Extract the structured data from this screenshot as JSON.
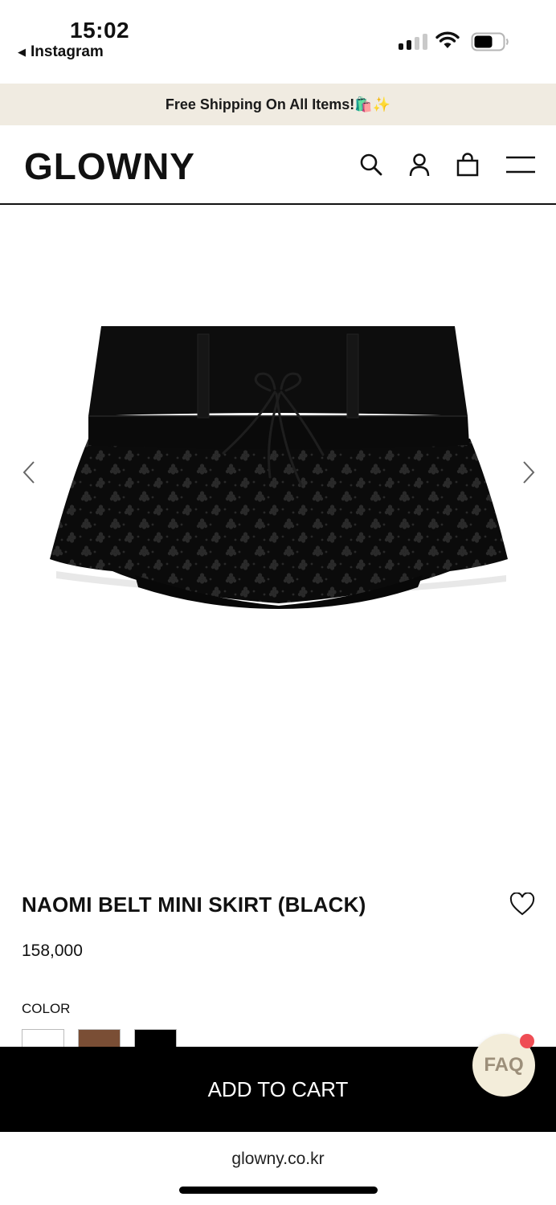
{
  "status_bar": {
    "time": "15:02",
    "back_app": "Instagram",
    "back_icon": "back-triangle-icon",
    "signal_bars": 4,
    "signal_active": 2
  },
  "announcement": {
    "text": "Free Shipping On All Items!🛍️✨"
  },
  "header": {
    "logo": "GLOWNY",
    "icons": [
      "search-icon",
      "account-icon",
      "bag-icon",
      "menu-icon"
    ]
  },
  "product": {
    "title": "NAOMI BELT MINI SKIRT (BLACK)",
    "price": "158,000",
    "color_label": "COLOR",
    "swatches": [
      {
        "name": "white",
        "color": "#ffffff"
      },
      {
        "name": "brown",
        "color": "#7a4e35"
      },
      {
        "name": "black",
        "color": "#000000"
      }
    ],
    "image_alt": "black eyelet mini skirt with belt and drawstring"
  },
  "cart": {
    "label": "ADD TO CART"
  },
  "faq": {
    "label": "FAQ",
    "notification_color": "#ef4d54"
  },
  "browser": {
    "url": "glowny.co.kr"
  },
  "colors": {
    "announcement_bg": "#f0ebe1",
    "cart_bg": "#000000",
    "faq_bg": "#f3edda"
  }
}
